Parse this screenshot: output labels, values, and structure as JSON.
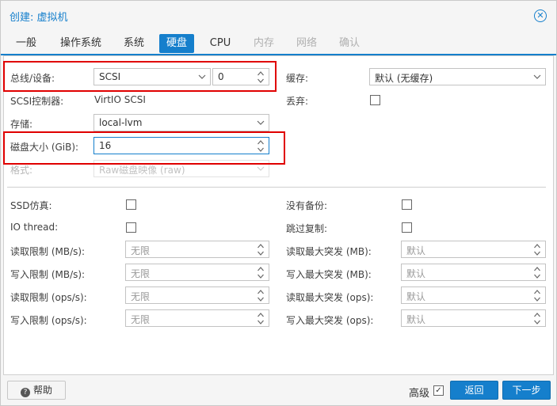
{
  "window": {
    "title": "创建: 虚拟机"
  },
  "tabs": [
    {
      "label": "一般",
      "state": "normal"
    },
    {
      "label": "操作系统",
      "state": "normal"
    },
    {
      "label": "系统",
      "state": "normal"
    },
    {
      "label": "硬盘",
      "state": "active"
    },
    {
      "label": "CPU",
      "state": "normal"
    },
    {
      "label": "内存",
      "state": "disabled"
    },
    {
      "label": "网络",
      "state": "disabled"
    },
    {
      "label": "确认",
      "state": "disabled"
    }
  ],
  "disk": {
    "bus_label": "总线/设备:",
    "bus_value": "SCSI",
    "device_value": "0",
    "controller_label": "SCSI控制器:",
    "controller_value": "VirtIO SCSI",
    "storage_label": "存储:",
    "storage_value": "local-lvm",
    "size_label": "磁盘大小 (GiB):",
    "size_value": "16",
    "format_label": "格式:",
    "format_value": "Raw磁盘映像 (raw)",
    "cache_label": "缓存:",
    "cache_value": "默认 (无缓存)",
    "discard_label": "丢弃:"
  },
  "advanced": {
    "ssd_label": "SSD仿真:",
    "iothread_label": "IO thread:",
    "nobackup_label": "没有备份:",
    "skipreplication_label": "跳过复制:",
    "read_limit_mb_label": "读取限制 (MB/s):",
    "write_limit_mb_label": "写入限制 (MB/s):",
    "read_limit_ops_label": "读取限制 (ops/s):",
    "write_limit_ops_label": "写入限制 (ops/s):",
    "unlimited_placeholder": "无限",
    "read_burst_mb_label": "读取最大突发 (MB):",
    "write_burst_mb_label": "写入最大突发 (MB):",
    "read_burst_ops_label": "读取最大突发 (ops):",
    "write_burst_ops_label": "写入最大突发 (ops):",
    "default_placeholder": "默认"
  },
  "footer": {
    "help_label": "帮助",
    "advanced_label": "高级",
    "advanced_checked": true,
    "back_label": "返回",
    "next_label": "下一步"
  },
  "icons": {
    "close": "close-icon",
    "help": "help-icon",
    "dropdown": "chevron-down-icon",
    "spinner": "spinner-icon"
  },
  "colors": {
    "accent": "#157fcc",
    "highlight": "#e00000"
  }
}
